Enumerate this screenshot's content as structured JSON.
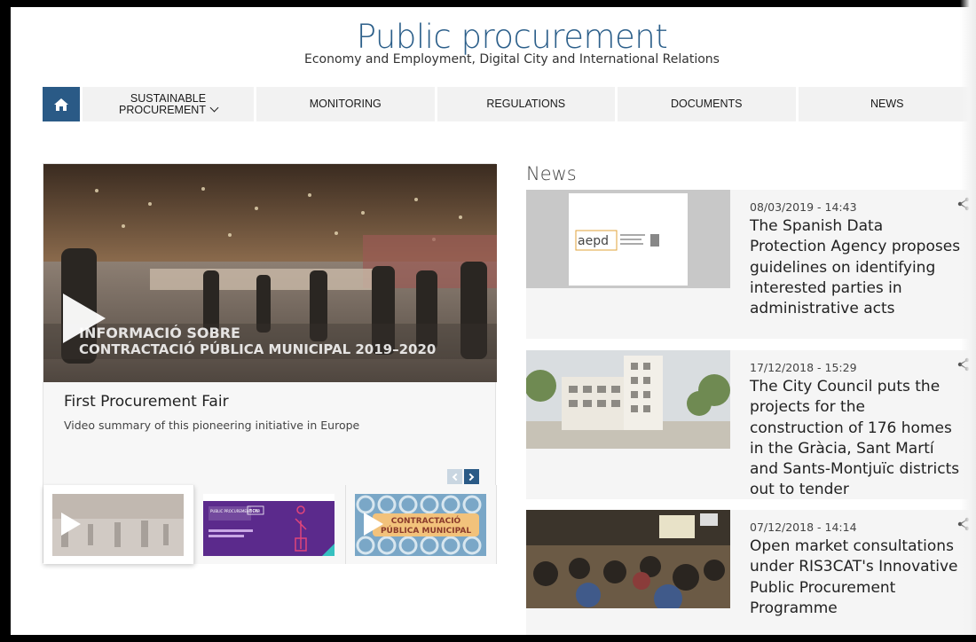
{
  "header": {
    "title": "Public procurement",
    "subtitle": "Economy and Employment, Digital City and International Relations"
  },
  "nav": {
    "home_icon": "home-icon",
    "items": [
      {
        "label": "SUSTAINABLE",
        "label2": "PROCUREMENT"
      },
      {
        "label": "MONITORING"
      },
      {
        "label": "REGULATIONS"
      },
      {
        "label": "DOCUMENTS"
      },
      {
        "label": "NEWS"
      }
    ]
  },
  "feature": {
    "overlay_line1": "INFORMACIÓ SOBRE",
    "overlay_line2": "CONTRACTACIÓ PÚBLICA MUNICIPAL 2019–2020",
    "title": "First Procurement Fair",
    "description": "Video summary of this pioneering initiative in Europe",
    "thumbs": [
      {
        "name": "video"
      },
      {
        "header": "PUBLIC PROCUREMENT FAIR",
        "badge": "BCN"
      },
      {
        "line1": "CONTRACTACIÓ",
        "line2": "PÚBLICA MUNICIPAL"
      }
    ]
  },
  "news": {
    "heading": "News",
    "items": [
      {
        "date": "08/03/2019 - 14:43",
        "title": "The Spanish Data Protection Agency proposes guidelines on identifying interested parties in administrative acts",
        "logo": "aepd"
      },
      {
        "date": "17/12/2018 - 15:29",
        "title": "The City Council puts the projects for the construction of 176 homes in the Gràcia, Sant Martí and Sants-Montjuïc districts out to tender"
      },
      {
        "date": "07/12/2018 - 14:14",
        "title": "Open market consultations under RIS3CAT's Innovative Public Procurement Programme"
      }
    ]
  },
  "colors": {
    "brand": "#2c5f8a",
    "nav_bg": "#f2f2f2",
    "home_bg": "#2a5a86"
  }
}
